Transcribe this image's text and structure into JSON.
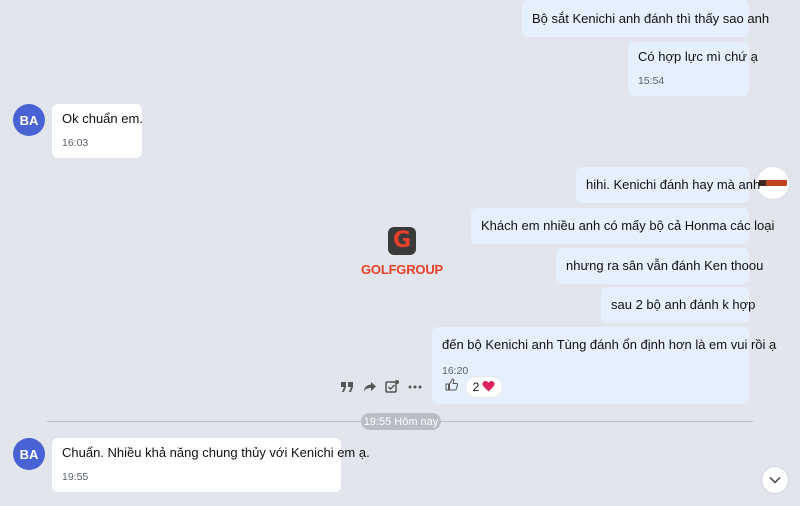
{
  "messages": [
    {
      "text": "Bộ sắt Kenichi anh đánh thì thấy sao anh",
      "time": ""
    },
    {
      "text": "Có hợp lực mì chứ ạ",
      "time": "15:54"
    },
    {
      "avatar": "BA",
      "text": "Ok chuẩn em.",
      "time": "16:03"
    },
    {
      "text": "hihi. Kenichi đánh hay mà anh",
      "time": ""
    },
    {
      "text": "Khách em nhiều anh có mấy bộ cả Honma các loại",
      "time": ""
    },
    {
      "text": "nhưng ra sân vẫn đánh Ken thoou",
      "time": ""
    },
    {
      "text": "sau 2 bộ anh đánh k hợp",
      "time": ""
    },
    {
      "text": "đến bộ Kenichi anh Tùng đánh ổn định hơn là em vui rồi ạ",
      "time": "16:20"
    },
    {
      "avatar": "BA",
      "text": "Chuẩn. Nhiều khả năng chung thủy với Kenichi em ạ.",
      "time": "19:55"
    }
  ],
  "reactions": {
    "count": "2",
    "icons": [
      "like-icon",
      "heart-icon"
    ],
    "heart_color": "#e0245e"
  },
  "divider": {
    "label": "19:55 Hôm nay"
  },
  "watermark": {
    "brand": "GOLFGROUP"
  },
  "hover_actions": [
    "quote-icon",
    "share-icon",
    "task-icon",
    "more-icon"
  ],
  "colors": {
    "my_bubble": "#e6effd",
    "their_bubble": "#ffffff",
    "avatar": "#4a63d4",
    "background": "#e2e5eb"
  }
}
